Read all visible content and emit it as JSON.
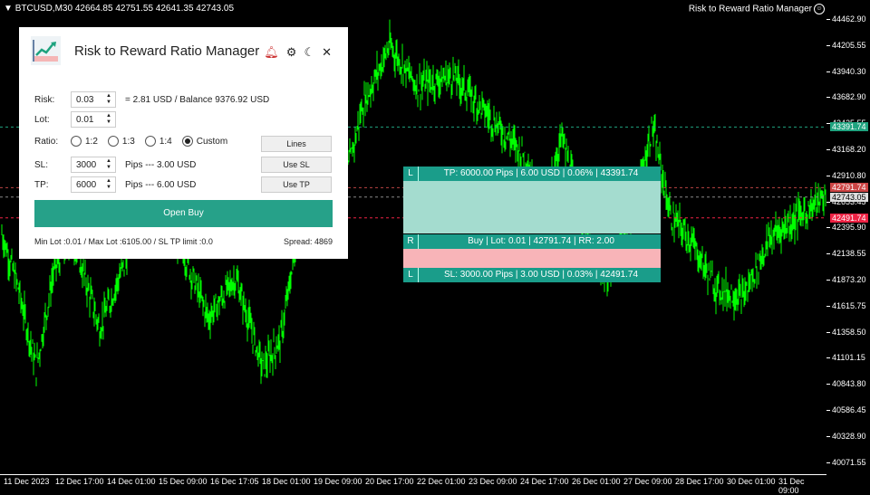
{
  "chart": {
    "symbol": "BTCUSD,M30",
    "ohlc": "42664.85 42751.55 42641.35 42743.05",
    "indicator_name": "Risk to Reward Ratio Manager",
    "price_ticks": [
      "44462.90",
      "44205.55",
      "43940.30",
      "43682.90",
      "43425.55",
      "43168.20",
      "42910.80",
      "42653.45",
      "42395.90",
      "42138.55",
      "41873.20",
      "41615.75",
      "41358.50",
      "41101.15",
      "40843.80",
      "40586.45",
      "40328.90",
      "40071.55"
    ],
    "price_badges": {
      "tp": "43391.74",
      "entry": "42791.74",
      "current": "42743.05",
      "sl": "42491.74"
    },
    "time_ticks": [
      "11 Dec 2023",
      "12 Dec 17:00",
      "14 Dec 01:00",
      "15 Dec 09:00",
      "16 Dec 17:05",
      "18 Dec 01:00",
      "19 Dec 09:00",
      "20 Dec 17:00",
      "22 Dec 01:00",
      "23 Dec 09:00",
      "24 Dec 17:00",
      "26 Dec 01:00",
      "27 Dec 09:00",
      "28 Dec 17:00",
      "30 Dec 01:00",
      "31 Dec 09:00"
    ],
    "colors": {
      "candles": "#00ff00",
      "tp_line": "#1fa37f",
      "entry_line": "#b44",
      "sl_line": "#e24",
      "tp_zone": "#a4dccf",
      "sl_zone": "#f8b4b8"
    }
  },
  "panel": {
    "title": "Risk to Reward Ratio Manager",
    "icons": [
      "bell-icon",
      "gear-icon",
      "moon-icon",
      "close-icon"
    ],
    "risk": {
      "label": "Risk:",
      "value": "0.03",
      "info": "= 2.81 USD  /  Balance  9376.92 USD"
    },
    "lot": {
      "label": "Lot:",
      "value": "0.01"
    },
    "ratio": {
      "label": "Ratio:",
      "options": [
        "1:2",
        "1:3",
        "1:4",
        "Custom"
      ],
      "selected": "Custom"
    },
    "sl": {
      "label": "SL:",
      "value": "3000",
      "info": "Pips  ---  3.00 USD"
    },
    "tp": {
      "label": "TP:",
      "value": "6000",
      "info": "Pips  ---  6.00 USD"
    },
    "buttons": {
      "lines": "Lines",
      "use_sl": "Use SL",
      "use_tp": "Use TP",
      "open_buy": "Open Buy"
    },
    "footer": {
      "limits": "Min Lot :0.01 / Max Lot :6105.00 / SL TP limit :0.0",
      "spread": "Spread:   4869"
    }
  },
  "overlay": {
    "tp": {
      "tag": "L",
      "text": "TP: 6000.00 Pips   |  6.00 USD   |  0.06%   |  43391.74"
    },
    "entry": {
      "tag": "R",
      "text": "Buy   |  Lot: 0.01   |  42791.74   |  RR: 2.00"
    },
    "sl": {
      "tag": "L",
      "text": "SL: 3000.00 Pips   |  3.00 USD   |  0.03%   |  42491.74"
    }
  }
}
